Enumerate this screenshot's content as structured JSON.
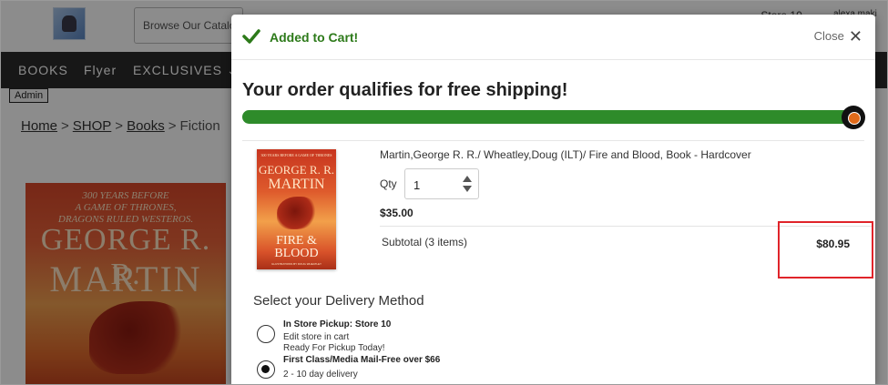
{
  "header": {
    "search_placeholder": "Browse Our Catalog",
    "store_label": "Store 10",
    "user_label": "alexa maki"
  },
  "nav": {
    "items": [
      "BOOKS",
      "Flyer",
      "EXCLUSIVES"
    ]
  },
  "admin_label": "Admin",
  "breadcrumb": {
    "home": "Home",
    "shop": "SHOP",
    "books": "Books",
    "current": "Fiction",
    "sep": ">"
  },
  "bg_cover": {
    "line1": "300 YEARS BEFORE",
    "line2": "A GAME OF THRONES,",
    "line3": "DRAGONS RULED WESTEROS.",
    "author1": "GEORGE R. R.",
    "author2": "MARTIN"
  },
  "modal": {
    "added_text": "Added to Cart!",
    "close_label": "Close",
    "ship_message": "Your order qualifies for free shipping!",
    "shipping_progress": 1.0,
    "accent_color": "#2e8b2a",
    "product": {
      "title": "Martin,George R. R./ Wheatley,Doug (ILT)/ Fire and Blood, Book - Hardcover",
      "qty_label": "Qty",
      "qty_value": "1",
      "price": "$35.00",
      "cover": {
        "top": "300 YEARS BEFORE A GAME OF THRONES",
        "author1": "GEORGE R. R.",
        "author2": "MARTIN",
        "title1": "FIRE &",
        "title2": "BLOOD",
        "illus": "ILLUSTRATIONS BY DOUG WHEATLEY"
      }
    },
    "subtotal_label": "Subtotal (3 items)",
    "subtotal_amount": "$80.95",
    "delivery": {
      "title": "Select your Delivery Method",
      "options": [
        {
          "title": "In Store Pickup: Store 10",
          "lines": [
            "Edit store in cart",
            "Ready For Pickup Today!"
          ],
          "selected": false
        },
        {
          "title": "First Class/Media Mail-Free over $66",
          "lines": [
            "2 - 10 day delivery"
          ],
          "selected": true
        }
      ]
    }
  }
}
